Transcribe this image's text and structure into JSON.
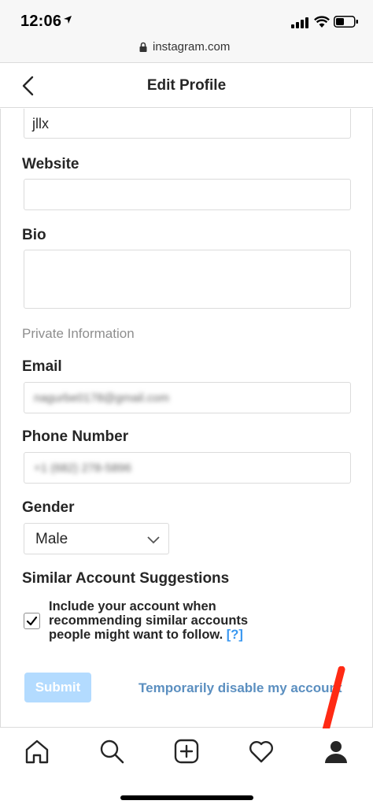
{
  "status_bar": {
    "time": "12:06"
  },
  "browser": {
    "url": "instagram.com"
  },
  "header": {
    "title": "Edit Profile"
  },
  "form": {
    "username_value": "jllx",
    "website_label": "Website",
    "website_value": "",
    "bio_label": "Bio",
    "bio_value": "",
    "private_info_heading": "Private Information",
    "email_label": "Email",
    "email_value": "nagurbe0178@gmail.com",
    "phone_label": "Phone Number",
    "phone_value": "+1 (682) 278-5896",
    "gender_label": "Gender",
    "gender_value": "Male",
    "suggestions_label": "Similar Account Suggestions",
    "suggestions_text": "Include your account when recommending similar accounts people might want to follow.",
    "suggestions_help": "[?]",
    "suggestions_checked": true,
    "submit_label": "Submit",
    "disable_link": "Temporarily disable my account"
  },
  "colors": {
    "link": "#5b8fc0",
    "submit_disabled": "#b3dbff",
    "annotation_arrow": "#ff2a14"
  },
  "tabbar": {
    "icons": [
      "home-icon",
      "search-icon",
      "new-post-icon",
      "activity-heart-icon",
      "profile-icon"
    ]
  }
}
